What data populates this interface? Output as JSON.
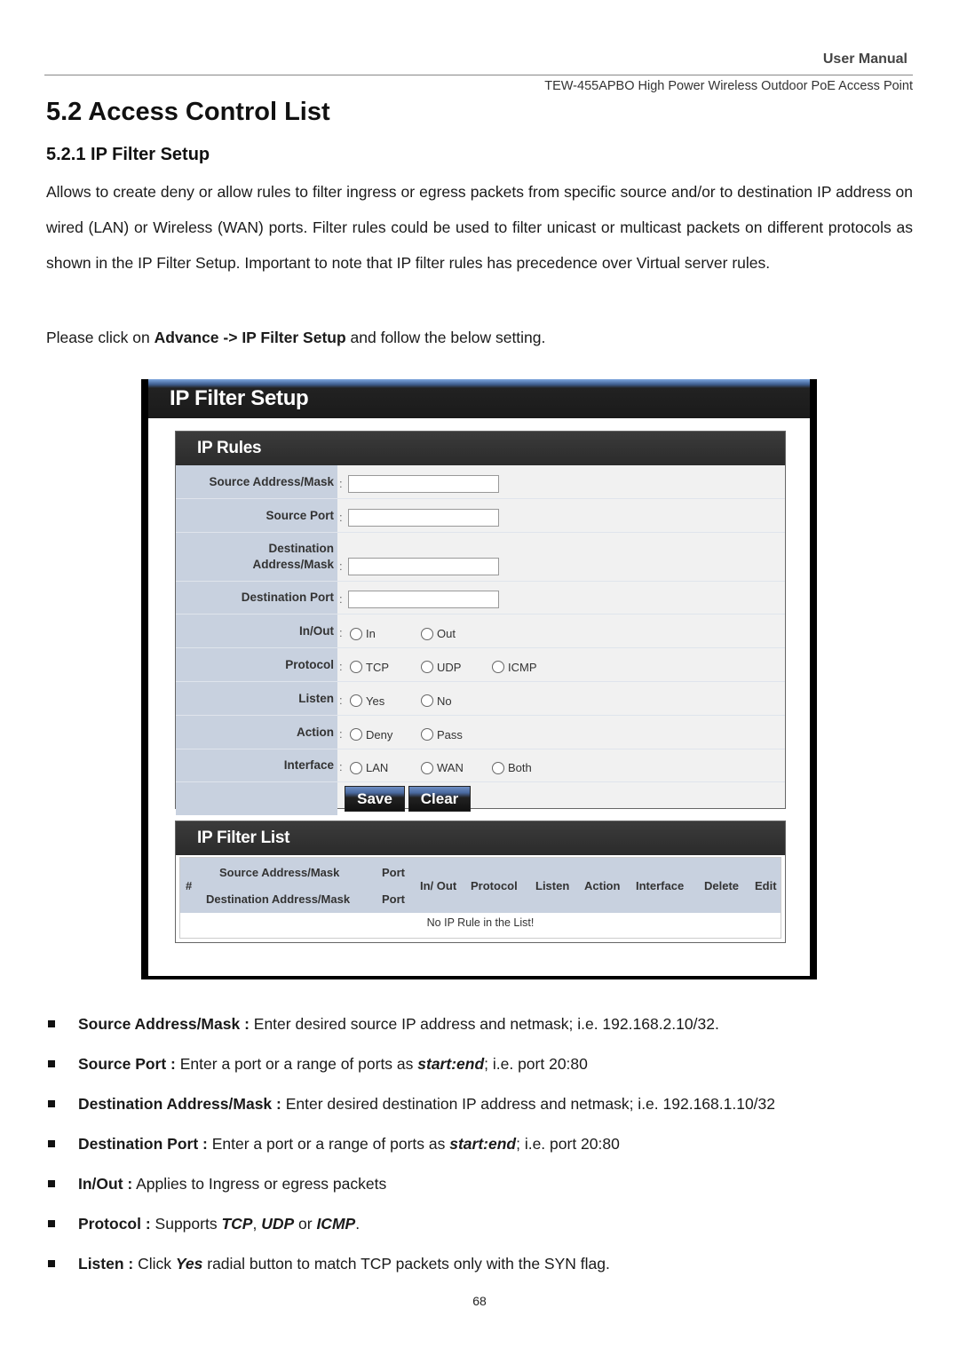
{
  "header": {
    "title": "User Manual",
    "subtitle": "TEW-455APBO High Power Wireless Outdoor PoE Access Point"
  },
  "section": {
    "heading": "5.2 Access Control List",
    "subheading": "5.2.1 IP Filter Setup",
    "paragraph": "Allows to create deny or allow rules to filter ingress or egress packets from specific source and/or to destination IP address on wired (LAN) or Wireless (WAN) ports.  Filter rules could be used to filter unicast or multicast packets on different protocols as shown in the IP Filter Setup. Important to note that IP filter rules has precedence over Virtual server rules.",
    "instruction_prefix": "Please click on ",
    "instruction_bold": "Advance -> IP Filter Setup",
    "instruction_suffix": " and follow the below setting."
  },
  "screenshot": {
    "title": "IP Filter Setup",
    "rules_panel": {
      "title": "IP Rules",
      "source_address_label": "Source Address/Mask",
      "source_address_value": "",
      "source_port_label": "Source Port",
      "source_port_value": "",
      "dest_address_label_1": "Destination",
      "dest_address_label_2": "Address/Mask",
      "dest_address_value": "",
      "dest_port_label": "Destination Port",
      "dest_port_value": "",
      "inout_label": "In/Out",
      "inout_options": [
        "In",
        "Out"
      ],
      "protocol_label": "Protocol",
      "protocol_options": [
        "TCP",
        "UDP",
        "ICMP"
      ],
      "listen_label": "Listen",
      "listen_options": [
        "Yes",
        "No"
      ],
      "action_label": "Action",
      "action_options": [
        "Deny",
        "Pass"
      ],
      "interface_label": "Interface",
      "interface_options": [
        "LAN",
        "WAN",
        "Both"
      ],
      "colon": ":",
      "save_button": "Save",
      "clear_button": "Clear"
    },
    "list_panel": {
      "title": "IP Filter List",
      "columns": {
        "num": "#",
        "source_address": "Source Address/Mask",
        "dest_address": "Destination Address/Mask",
        "source_port": "Port",
        "dest_port": "Port",
        "inout": "In/ Out",
        "protocol": "Protocol",
        "listen": "Listen",
        "action": "Action",
        "interface": "Interface",
        "delete": "Delete",
        "edit": "Edit"
      },
      "empty_message": "No IP Rule in the List!"
    }
  },
  "bullets": [
    {
      "label": "Source Address/Mask :",
      "text": " Enter desired source IP address and netmask; i.e. 192.168.2.10/32."
    },
    {
      "label": "Source Port :",
      "text_pre": " Enter a port or a range of ports as ",
      "em": "start:end",
      "text_post": "; i.e. port 20:80"
    },
    {
      "label": "Destination Address/Mask :",
      "text": " Enter desired destination IP address and netmask; i.e. 192.168.1.10/32"
    },
    {
      "label": "Destination Port :",
      "text_pre": " Enter a port or a range of ports as ",
      "em": "start:end",
      "text_post": "; i.e. port 20:80"
    },
    {
      "label": "In/Out :",
      "text": " Applies to Ingress or egress packets"
    },
    {
      "label": "Protocol :",
      "text_pre": " Supports ",
      "em1": "TCP",
      "sep1": ", ",
      "em2": "UDP",
      "sep2": " or ",
      "em3": "ICMP",
      "text_post": "."
    },
    {
      "label": "Listen :",
      "text_pre": " Click ",
      "em": "Yes",
      "text_post": " radial button to match TCP packets only with the SYN flag."
    }
  ],
  "page_number": "68"
}
